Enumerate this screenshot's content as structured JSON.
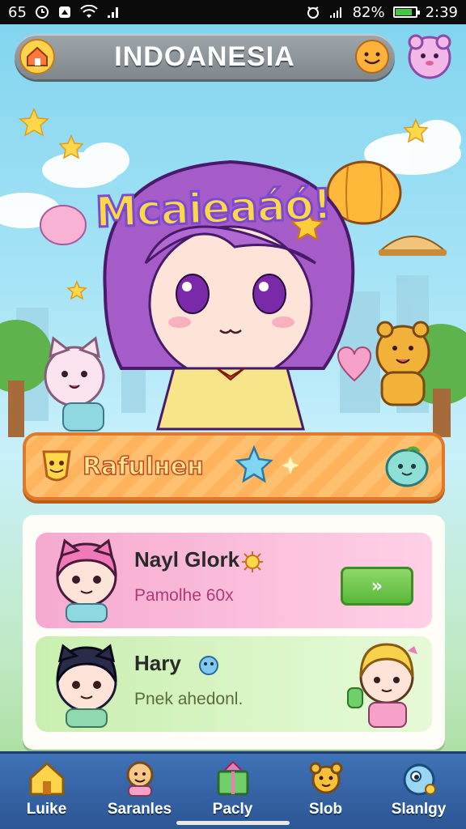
{
  "status_bar": {
    "time_left": "65",
    "battery_percent": "82%",
    "time_right": "2:39"
  },
  "topbar": {
    "title": "INDOANESIA"
  },
  "hero": {
    "title": "Mcaieaáó!"
  },
  "rank_banner": {
    "label": "Rafulнeн"
  },
  "list": [
    {
      "name": "Nayl Glork",
      "subtitle": "Pamolhe 60x",
      "action": "»"
    },
    {
      "name": "Hary",
      "subtitle": "Pnek ahedonl."
    }
  ],
  "bottom_nav": [
    {
      "label": "Luike",
      "icon": "house-icon"
    },
    {
      "label": "Saranles",
      "icon": "character-icon"
    },
    {
      "label": "Pacly",
      "icon": "gift-box-icon"
    },
    {
      "label": "Slob",
      "icon": "bear-icon"
    },
    {
      "label": "Slanlgy",
      "icon": "blob-icon"
    }
  ],
  "colors": {
    "accent_orange": "#ffb35c",
    "nav_blue": "#3f72b6",
    "pink_card": "#f6a9cf",
    "green_card": "#c9efb0",
    "go_button": "#58b83a"
  }
}
